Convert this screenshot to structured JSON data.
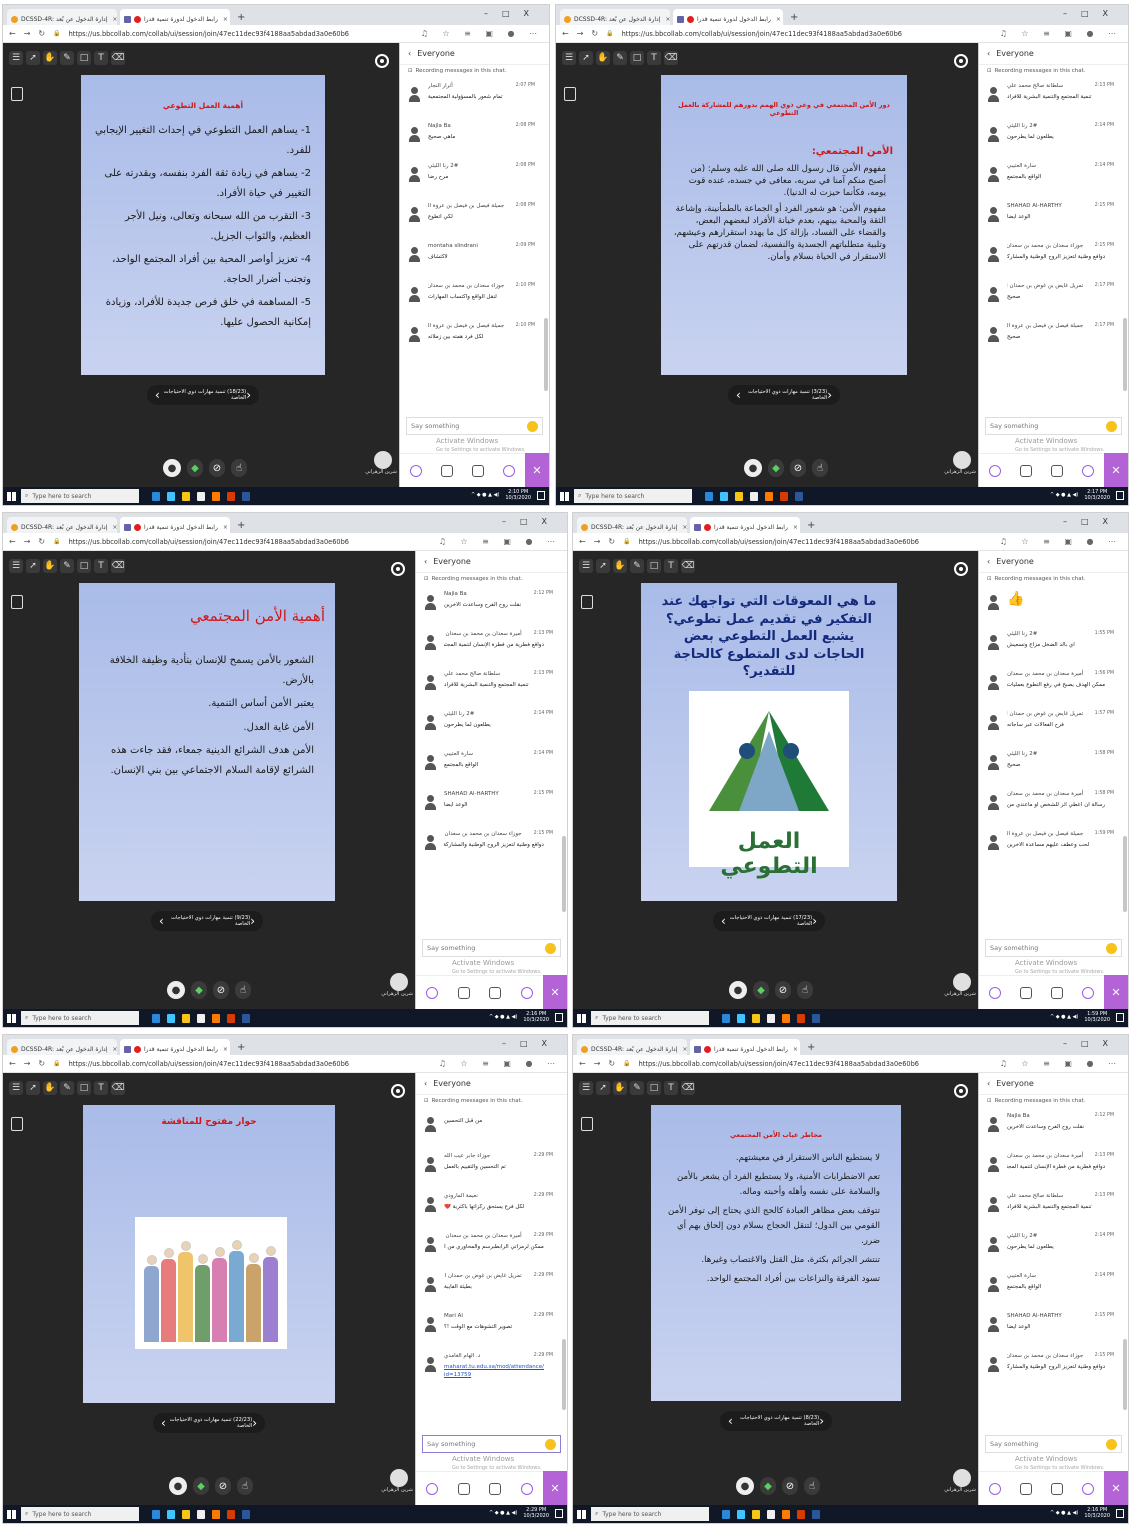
{
  "browser": {
    "tab1_title": "DCSSD-4R: إدارة الدخول عن بُعد",
    "tab2_title": "رابط الدخول لدورة تنمية قدرا",
    "url": "https://us.bbcollab.com/collab/ui/session/join/47ec11dec93f4188aa5abdad3a0e60b6",
    "new_tab": "+",
    "minimize": "–",
    "maximize": "□",
    "close": "X"
  },
  "chat": {
    "scope": "Everyone",
    "recording_notice": "Recording messages in this chat.",
    "placeholder": "Say something",
    "activate_windows": "Activate Windows",
    "activate_sub": "Go to Settings to activate Windows."
  },
  "taskbar": {
    "search": "Type here to search",
    "date": "10/3/2020"
  },
  "teacher_name": "شرين الزهراني",
  "panels": [
    {
      "slide_title": "أهمية العمل التطوعي",
      "slide_lines": [
        "1- يساهم العمل التطوعي في إحداث التغيير الإيجابي للفرد.",
        "2- يساهم في زيادة ثقة الفرد بنفسه، وبقدرته على التغيير في حياة الأفراد.",
        "3- التقرب من الله سبحانه وتعالى، ونيل الأجر العظيم، والثواب الجزيل.",
        "4- تعزيز أواصر المحبة بين أفراد المجتمع الواحد، وتجنب أضرار الحاجة.",
        "5- المساهمة في خلق فرص جديدة للأفراد، وزيادة إمكانية الحصول عليها."
      ],
      "nav_label": "(18/23) تنمية مهارات ذوي الاحتياجات الخاصة",
      "clock": "2:10 PM",
      "messages": [
        {
          "who": "أثرار النجار",
          "time": "2:07 PM",
          "text": "تمام شعور بالمسؤولية المجتمعية"
        },
        {
          "who": "Najla Ba",
          "time": "2:08 PM",
          "text": "ماهي صحيح"
        },
        {
          "who": "2# رنا الليثي",
          "time": "2:08 PM",
          "text": "مرح رضا"
        },
        {
          "who": "جميلة فيصل بن فيصل بن عروة الحربي",
          "time": "2:08 PM",
          "text": "لكي أتطوع"
        },
        {
          "who": "montaha slindrani",
          "time": "2:09 PM",
          "text": "لاكتشاف"
        },
        {
          "who": "جوزاء سعدان بن محمد بن سعدان المصعب",
          "time": "2:10 PM",
          "text": "لنقل الواقع واكتساب المهارات"
        },
        {
          "who": "جميلة فيصل بن فيصل بن عروة الحربي",
          "time": "2:10 PM",
          "text": "لكل فرد همته بين زملائه"
        }
      ]
    },
    {
      "slide_title": "دور الأمن المجتمعي في وعي ذوي الهمم بدورهم للمشاركة بالعمل التطوعي",
      "section_title": "الأمن المجتمعي:",
      "slide_lines": [
        "مفهوم الأمن قال رسول الله صلى الله عليه وسلم: (من أصبح منكم آمنا في سربه، معافى في جسده، عنده قوت يومه، فكأنما حيزت له الدنيا).",
        "مفهوم الأمن: هو شعور الفرد أو الجماعة بالطمأنينة، وإشاعة الثقة والمحبة بينهم، بعدم خيانة الأفراد لبعضهم البعض، والقضاء على الفساد، بإزالة كل ما يهدد استقرارهم وعيشهم، وتلبية متطلباتهم الجسدية والنفسية، لضمان قدرتهم على الاستقرار في الحياة بسلام وأمان."
      ],
      "nav_label": "(3/23) تنمية مهارات ذوي الاحتياجات الخاصة",
      "clock": "2:17 PM",
      "messages": [
        {
          "who": "سلطانة صالح محمد علي",
          "time": "2:13 PM",
          "text": "تنمية المجتمع والتنمية البشرية للأفراد"
        },
        {
          "who": "2# رنا الليثي",
          "time": "2:14 PM",
          "text": "يطلعون لما يطرحون"
        },
        {
          "who": "سارة العتيبي",
          "time": "2:14 PM",
          "text": "الواقع بالمجتمع"
        },
        {
          "who": "SHAHAD Al-HARTHY",
          "time": "2:15 PM",
          "text": "الوعد ايضا"
        },
        {
          "who": "جوزاء سعدان بن محمد بن سعدان المصعب",
          "time": "2:15 PM",
          "text": "دوافع وطنية لتعزيز الروح الوطنية والمشاركة في الحفاظ على استقرار الوطن"
        },
        {
          "who": "تمريل غايض بن غوض بن حمدان الشاعر",
          "time": "2:17 PM",
          "text": "صحيح"
        },
        {
          "who": "جميلة فيصل بن فيصل بن عروة الحربي",
          "time": "2:17 PM",
          "text": "صحيح"
        }
      ]
    },
    {
      "slide_title": "أهمية الأمن المجتمعي",
      "slide_lines": [
        "الشعور بالأمن يسمح للإنسان بتأدية وظيفة الخلافة بالأرض.",
        "يعتبر الأمن أساس التنمية.",
        "الأمن غاية العدل.",
        "الأمن هدف الشرائع الدينية جمعاء، فقد جاءت هذه الشرائع لإقامة السلام الاجتماعي بين بني الإنسان."
      ],
      "nav_label": "(9/23) تنمية مهارات ذوي الاحتياجات الخاصة",
      "clock": "2:16 PM",
      "messages": [
        {
          "who": "Najla Ba",
          "time": "2:12 PM",
          "text": "نقلت روح الفرح وساعدت الآخرين"
        },
        {
          "who": "أميرة سعدان بن محمد بن سعدان المصعب",
          "time": "2:13 PM",
          "text": "دوافع فطرية من فطرة الإنسان لتنمية المجتمع"
        },
        {
          "who": "سلطانة صالح محمد علي",
          "time": "2:13 PM",
          "text": "تنمية المجتمع والتنمية البشرية للأفراد"
        },
        {
          "who": "2# رنا الليثي",
          "time": "2:14 PM",
          "text": "يطلعون لما يطرحون"
        },
        {
          "who": "سارة العتيبي",
          "time": "2:14 PM",
          "text": "الواقع بالمجتمع"
        },
        {
          "who": "SHAHAD Al-HARTHY",
          "time": "2:15 PM",
          "text": "الوعد ايضا"
        },
        {
          "who": "جوزاء سعدان بن محمد بن سعدان المصعب",
          "time": "2:15 PM",
          "text": "دوافع وطنية لتعزيز الروح الوطنية والمشاركة في الحفاظ على استقرار الوطن"
        }
      ]
    },
    {
      "slide_title": "ما هي المعوقات التي تواجهك عند التفكير في تقديم عمل تطوعي؟ يشبع العمل التطوعي بعض الحاجات لدى المتطوع كالحاجة للتقدير؟",
      "logo_text": "العمل التطوعي",
      "nav_label": "(17/23) تنمية مهارات ذوي الاحتياجات الخاصة",
      "clock": "1:59 PM",
      "messages": [
        {
          "who": "",
          "time": "",
          "text": "👍"
        },
        {
          "who": "2# رنا الليثي",
          "time": "1:55 PM",
          "text": "أي بالد الضخل مزاج وتسعيش"
        },
        {
          "who": "أميرة سعدان بن محمد بن سعدان المصعب",
          "time": "1:56 PM",
          "text": "ممكن الهدف يصبح في رفع التطوع بعمليات جديدة"
        },
        {
          "who": "تمريل غايض بن غوض بن حمدان الشاعر",
          "time": "1:57 PM",
          "text": "فرح الفعالات عبر ساجاته"
        },
        {
          "who": "2# رنا الليثي",
          "time": "1:58 PM",
          "text": "صحيح"
        },
        {
          "who": "أميرة سعدان بن محمد بن سعدان المصعب",
          "time": "1:58 PM",
          "text": "رسالة أن أعطي أثر للشخص أو ماعندي من تطوع"
        },
        {
          "who": "جميلة فيصل بن فيصل بن عروة الحربي",
          "time": "1:59 PM",
          "text": "لحب وعطف عليهم مساعدة الآخرين"
        }
      ]
    },
    {
      "slide_title": "حوار مفتوح للمناقشة",
      "nav_label": "(22/23) تنمية مهارات ذوي الاحتياجات الخاصة",
      "clock": "2:29 PM",
      "messages": [
        {
          "who": "",
          "time": "",
          "text": "من قبل التحسين"
        },
        {
          "who": "جوزاء جابر عيب الله",
          "time": "2:29 PM",
          "text": "تم التحسين والتقييم بالعمل"
        },
        {
          "who": "نعيمة المارودي",
          "time": "2:29 PM",
          "text": "لكل فرع يستحق ركزاتها بأكثرية ❤️"
        },
        {
          "who": "أميرة سعدان بن محمد بن سعدان المصعب",
          "time": "2:29 PM",
          "text": "ممكن لرمزاتي الرابطبرسم والمحاوري من المشكلة أن تغرض"
        },
        {
          "who": "تمريل غايض بن غوض بن حمدان الشاعر",
          "time": "2:29 PM",
          "text": "بطيئة الفايبة"
        },
        {
          "who": "Mari Al",
          "time": "2:29 PM",
          "text": "تصوير التشوهات مع الوقت !؟"
        },
        {
          "who": "د. الهام الغامدي",
          "time": "2:29 PM",
          "text": "maharat.tu.edu.sa/mod/attendance/manage.php?id=13759"
        }
      ]
    },
    {
      "slide_title": "مخاطر غياب الأمن المجتمعي",
      "slide_lines": [
        "لا يستطيع الناس الاستقرار في معيشتهم.",
        "تعم الاضطرابات الأمنية، ولا يستطيع الفرد أن يشعر بالأمن والسلامة على نفسه وأهله وأحبته وماله.",
        "تتوقف بعض مظاهر العبادة كالحج الذي يحتاج إلى توفر الأمن القومي بين الدول؛ لتنقل الحجاج بسلام دون إلحاق بهم أي ضرر.",
        "تنتشر الجرائم بكثرة، مثل القتل والاغتصاب وغيرها.",
        "تسود الفرقة والنزاعات بين أفراد المجتمع الواحد."
      ],
      "nav_label": "(8/23) تنمية مهارات ذوي الاحتياجات الخاصة",
      "clock": "2:16 PM",
      "messages": [
        {
          "who": "Najla Ba",
          "time": "2:12 PM",
          "text": "نقلت روح الفرح وساعدت الآخرين"
        },
        {
          "who": "أميرة سعدان بن محمد بن سعدان المصعب",
          "time": "2:13 PM",
          "text": "دوافع فطرية من فطرة الإنسان لتنمية المجتمع"
        },
        {
          "who": "سلطانة صالح محمد علي",
          "time": "2:13 PM",
          "text": "تنمية المجتمع والتنمية البشرية للأفراد"
        },
        {
          "who": "2# رنا الليثي",
          "time": "2:14 PM",
          "text": "يطلعون لما يطرحون"
        },
        {
          "who": "سارة العتيبي",
          "time": "2:14 PM",
          "text": "الواقع بالمجتمع"
        },
        {
          "who": "SHAHAD Al-HARTHY",
          "time": "2:15 PM",
          "text": "الوعد ايضا"
        },
        {
          "who": "جوزاء سعدان بن محمد بن سعدان المصعب",
          "time": "2:15 PM",
          "text": "دوافع وطنية لتعزيز الروح الوطنية والمشاركة في الحفاظ على استقرار الوطن"
        }
      ]
    }
  ]
}
